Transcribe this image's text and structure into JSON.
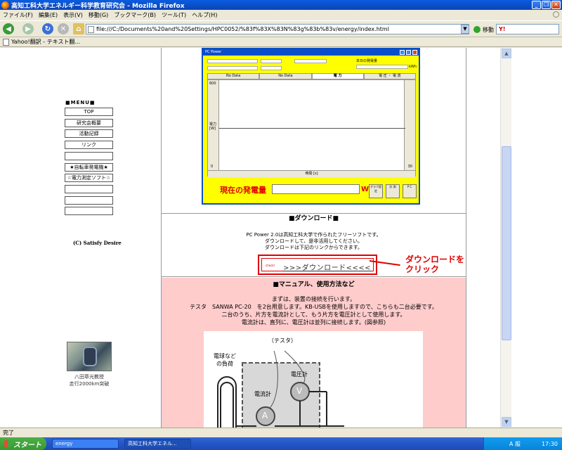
{
  "window": {
    "title": "高知工科大学エネルギー科学教育研究会 - Mozilla Firefox",
    "minimize": "_",
    "restore": "❐",
    "close": "✕"
  },
  "menubar": [
    "ファイル(F)",
    "編集(E)",
    "表示(V)",
    "移動(G)",
    "ブックマーク(B)",
    "ツール(T)",
    "ヘルプ(H)"
  ],
  "navbar": {
    "url": "file:///C:/Documents%20and%20Settings/HPC0052/%83f%83X%83N%83g%83b%83v/energy/index.html",
    "go_label": "移動",
    "search_placeholder": ""
  },
  "bookmarks": {
    "item1": "Yahoo!翻訳 - テキスト翻..."
  },
  "sidebar": {
    "menu_title": "■MENU■",
    "items": [
      "TOP",
      "研究会概要",
      "活動記録",
      "リンク",
      "",
      "★自転車発電機★",
      "☆電力測定ソフト☆",
      "",
      "",
      ""
    ],
    "copyright": "(C) Satisfy Desire",
    "photo_caption": [
      "八田章光教授",
      "走行2000km突破"
    ]
  },
  "app": {
    "title": "PC Power",
    "today_label": "本日の発電量",
    "today_unit": "kWh",
    "tabs": [
      "No Data",
      "No Data",
      "電 力",
      "電 圧 ・ 電 流"
    ],
    "y_top": "600",
    "y_bottom": "0",
    "y_label": "電力\n[W]",
    "x_right": "30",
    "x_label": "時間 [s]",
    "current_power_label": "現在の発電量",
    "current_power_unit": "W",
    "buttons": [
      "グラフ設定",
      "計 測",
      "P C"
    ]
  },
  "download": {
    "heading": "■ダウンロード■",
    "lines": [
      "PC Power 2.0は高知工科大学で作られたフリーソフトです。",
      "ダウンロードして、是非活用してください。",
      "ダウンロードは下記のリンクからできます。"
    ],
    "check_text": "check!",
    "link_text": ">>>ダウンロード<<<<",
    "annotation": [
      "ダウンロードを",
      "クリック"
    ]
  },
  "manual": {
    "heading": "■マニュアル、使用方法など",
    "lines": [
      "まずは、装置の接続を行います。",
      "テスタ　SANWA PC-20　を2台用意します。KB-USBを使用しますので、こちらも二台必要です。",
      "二台のうち、片方を電流計として、もう片方を電圧計として使用します。",
      "電流計は、直列に、電圧計は並列に接続します。(図参照)"
    ],
    "diagram": {
      "tester_label": "（テスタ）",
      "load_label": [
        "電球など",
        "の負荷"
      ],
      "ammeter_label": "電流計",
      "voltmeter_label": "電圧計",
      "ammeter_symbol": "A",
      "voltmeter_symbol": "V"
    }
  },
  "statusbar": {
    "text": "完了"
  },
  "taskbar": {
    "start": "スタート",
    "tasks": [
      "energy",
      "高知工科大学エネル..."
    ],
    "tray_text": "A 般",
    "clock": "17:30"
  }
}
